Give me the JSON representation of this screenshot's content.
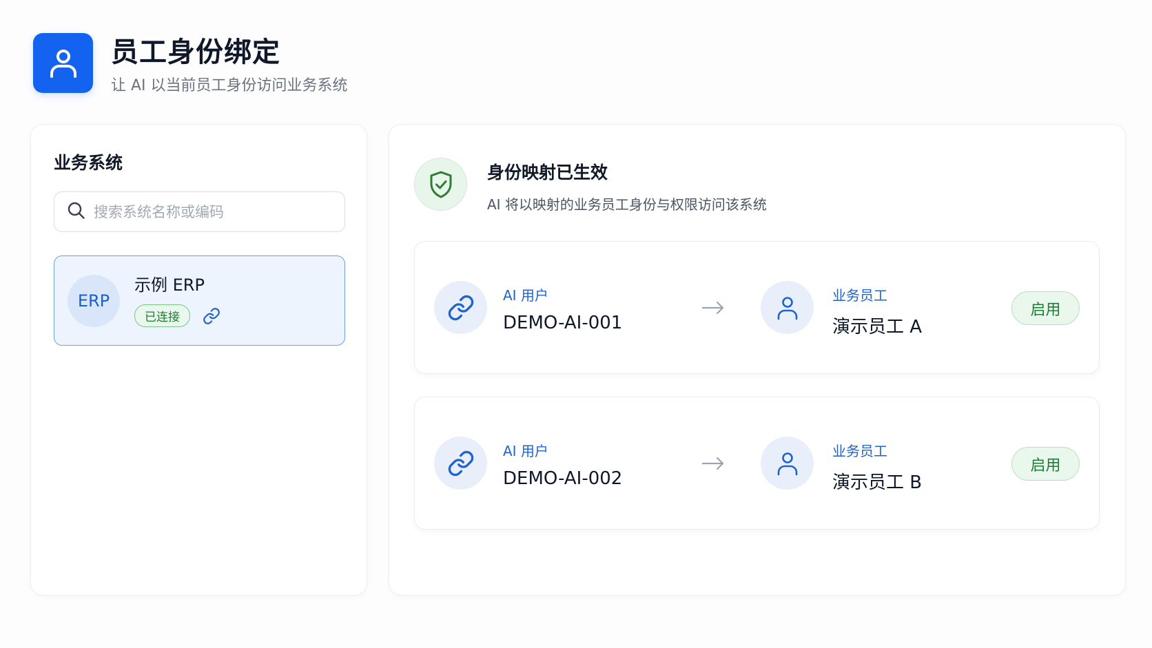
{
  "header": {
    "icon": "user-icon",
    "title": "员工身份绑定",
    "subtitle": "让 AI 以当前员工身份访问业务系统"
  },
  "sidebar": {
    "title": "业务系统",
    "search": {
      "placeholder": "搜索系统名称或编码",
      "value": ""
    },
    "systems": [
      {
        "avatar": "ERP",
        "name": "示例 ERP",
        "status": "已连接",
        "icon": "link-icon",
        "selected": true
      }
    ]
  },
  "main": {
    "status": {
      "icon": "shield-check-icon",
      "title": "身份映射已生效",
      "subtitle": "AI 将以映射的业务员工身份与权限访问该系统"
    },
    "mappings": [
      {
        "ai_label": "AI 用户",
        "ai_value": "DEMO-AI-001",
        "employee_label": "业务员工",
        "employee_value": "演示员工 A",
        "toggle_label": "启用"
      },
      {
        "ai_label": "AI 用户",
        "ai_value": "DEMO-AI-002",
        "employee_label": "业务员工",
        "employee_value": "演示员工 B",
        "toggle_label": "启用"
      }
    ]
  },
  "colors": {
    "brand": "#1463f0",
    "accent_blue": "#1f63cc",
    "success": "#1f7a36",
    "success_bg": "#eaf7ec"
  }
}
